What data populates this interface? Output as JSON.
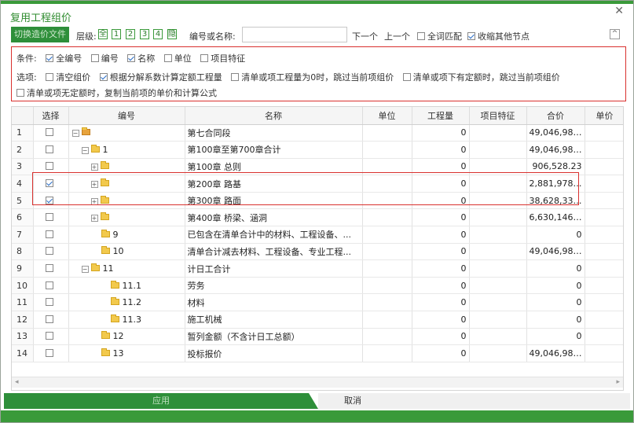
{
  "dialog": {
    "title": "复用工程组价",
    "close": "✕"
  },
  "toolbar": {
    "import_label": "切换造价文件",
    "level_label": "层级:",
    "levels": [
      "全",
      "1",
      "2",
      "3",
      "4",
      "隐"
    ],
    "search_label": "编号或名称:",
    "search_value": "",
    "next_label": "下一个",
    "prev_label": "上一个",
    "full_match_label": "全词匹配",
    "full_match_checked": false,
    "collapse_others_label": "收缩其他节点",
    "collapse_others_checked": true,
    "collapse_glyph": "^"
  },
  "conditions": {
    "label": "条件:",
    "items": [
      {
        "label": "全编号",
        "checked": true
      },
      {
        "label": "编号",
        "checked": false
      },
      {
        "label": "名称",
        "checked": true
      },
      {
        "label": "单位",
        "checked": false
      },
      {
        "label": "项目特征",
        "checked": false
      }
    ]
  },
  "options": {
    "label": "选项:",
    "items": [
      {
        "label": "清空组价",
        "checked": false
      },
      {
        "label": "根据分解系数计算定额工程量",
        "checked": true
      },
      {
        "label": "清单或项工程量为0时，跳过当前项组价",
        "checked": false
      },
      {
        "label": "清单或项下有定额时，跳过当前项组价",
        "checked": false
      }
    ],
    "extra": {
      "label": "清单或项无定额时，复制当前项的单价和计算公式",
      "checked": false
    }
  },
  "table": {
    "columns": [
      "",
      "选择",
      "编号",
      "名称",
      "单位",
      "工程量",
      "项目特征",
      "合价",
      "单价"
    ],
    "rows": [
      {
        "n": "1",
        "checked": false,
        "indent": 0,
        "toggle": "−",
        "code": "",
        "name": "第七合同段",
        "unit": "",
        "qty": "0",
        "feature": "",
        "total": "49,046,985....",
        "price": ""
      },
      {
        "n": "2",
        "checked": false,
        "indent": 1,
        "toggle": "−",
        "code": "1",
        "name": "第100章至第700章合计",
        "unit": "",
        "qty": "0",
        "feature": "",
        "total": "49,046,985....",
        "price": ""
      },
      {
        "n": "3",
        "checked": false,
        "indent": 2,
        "toggle": "+",
        "code": "",
        "name": "第100章  总则",
        "unit": "",
        "qty": "0",
        "feature": "",
        "total": "906,528.23",
        "price": ""
      },
      {
        "n": "4",
        "checked": true,
        "indent": 2,
        "toggle": "+",
        "code": "",
        "name": "第200章  路基",
        "unit": "",
        "qty": "0",
        "feature": "",
        "total": "2,881,978.77",
        "price": ""
      },
      {
        "n": "5",
        "checked": true,
        "indent": 2,
        "toggle": "+",
        "code": "",
        "name": "第300章  路面",
        "unit": "",
        "qty": "0",
        "feature": "",
        "total": "38,628,331....",
        "price": ""
      },
      {
        "n": "6",
        "checked": false,
        "indent": 2,
        "toggle": "+",
        "code": "",
        "name": "第400章  桥梁、涵洞",
        "unit": "",
        "qty": "0",
        "feature": "",
        "total": "6,630,146.79",
        "price": ""
      },
      {
        "n": "7",
        "checked": false,
        "indent": 2,
        "toggle": "",
        "code": "9",
        "name": "已包含在清单合计中的材料、工程设备、...",
        "unit": "",
        "qty": "0",
        "feature": "",
        "total": "0",
        "price": ""
      },
      {
        "n": "8",
        "checked": false,
        "indent": 2,
        "toggle": "",
        "code": "10",
        "name": "清单合计减去材料、工程设备、专业工程...",
        "unit": "",
        "qty": "0",
        "feature": "",
        "total": "49,046,985....",
        "price": ""
      },
      {
        "n": "9",
        "checked": false,
        "indent": 1,
        "toggle": "−",
        "code": "11",
        "name": "计日工合计",
        "unit": "",
        "qty": "0",
        "feature": "",
        "total": "0",
        "price": ""
      },
      {
        "n": "10",
        "checked": false,
        "indent": 3,
        "toggle": "",
        "code": "11.1",
        "name": "劳务",
        "unit": "",
        "qty": "0",
        "feature": "",
        "total": "0",
        "price": ""
      },
      {
        "n": "11",
        "checked": false,
        "indent": 3,
        "toggle": "",
        "code": "11.2",
        "name": "材料",
        "unit": "",
        "qty": "0",
        "feature": "",
        "total": "0",
        "price": ""
      },
      {
        "n": "12",
        "checked": false,
        "indent": 3,
        "toggle": "",
        "code": "11.3",
        "name": "施工机械",
        "unit": "",
        "qty": "0",
        "feature": "",
        "total": "0",
        "price": ""
      },
      {
        "n": "13",
        "checked": false,
        "indent": 2,
        "toggle": "",
        "code": "12",
        "name": "暂列金额（不含计日工总额）",
        "unit": "",
        "qty": "0",
        "feature": "",
        "total": "0",
        "price": ""
      },
      {
        "n": "14",
        "checked": false,
        "indent": 2,
        "toggle": "",
        "code": "13",
        "name": "投标报价",
        "unit": "",
        "qty": "0",
        "feature": "",
        "total": "49,046,985....",
        "price": ""
      }
    ]
  },
  "footer": {
    "apply_label": "应用",
    "cancel_label": "取消"
  },
  "colors": {
    "accent": "#2e8f3a",
    "highlight": "#d9302e"
  }
}
